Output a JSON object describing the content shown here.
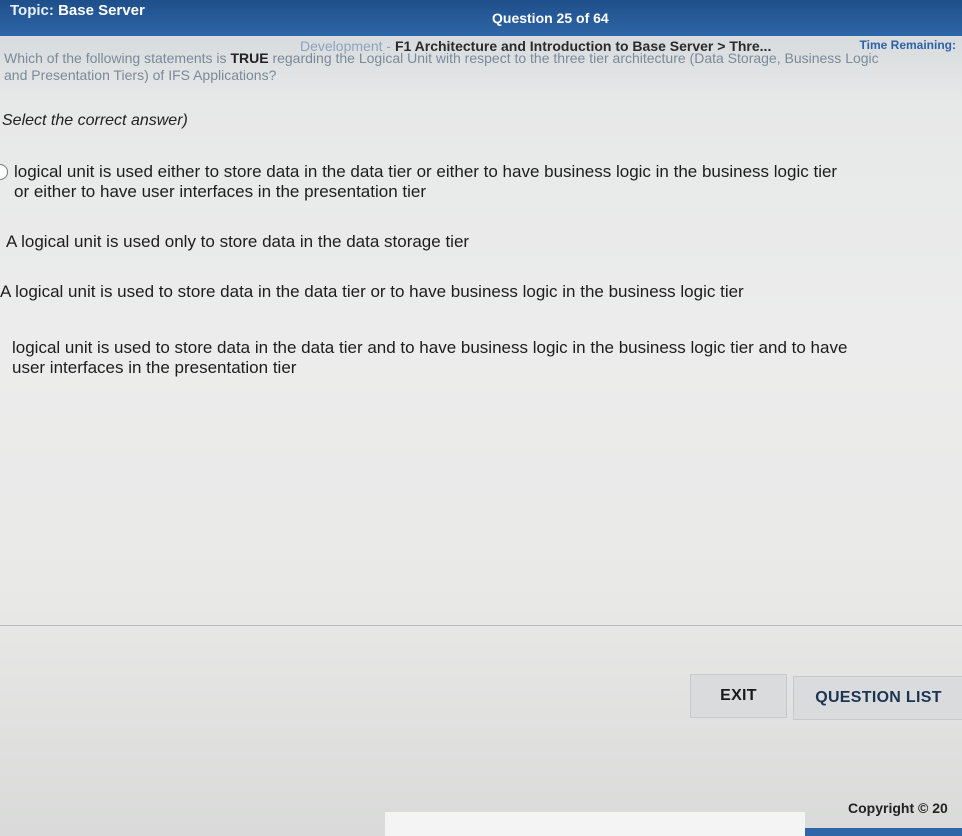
{
  "header": {
    "topic_label": "Topic:",
    "topic_name": "Base Server",
    "topic_faded": "Development - ",
    "topic_rest": "F1 Architecture and Introduction to Base Server > Thre...",
    "question_counter": "Question 25 of 64",
    "time_remaining": "Time Remaining:"
  },
  "question": {
    "text_part1": "Which of the following statements is ",
    "emphasis": "TRUE",
    "text_part2": " regarding the Logical Unit with respect to the three tier architecture (Data Storage, Business Logic and Presentation Tiers) of IFS Applications?",
    "instruction": "Select the correct answer)"
  },
  "options": [
    {
      "text": "logical unit is used either to store data in the data tier or either to have business logic in the business logic tier or either to have user interfaces in the presentation tier"
    },
    {
      "text": "A logical unit is used only to store data in the data storage tier"
    },
    {
      "text": "A logical unit is used to store data in the data tier or to have business logic in the business logic tier"
    },
    {
      "text": "logical unit is used to store data in the data tier and to have business logic in the business logic tier and to have user interfaces in the presentation tier"
    }
  ],
  "footer": {
    "exit_label": "EXIT",
    "question_list_label": "QUESTION LIST",
    "copyright": "Copyright © 20"
  },
  "colors": {
    "topbar": "#2f66a8",
    "accent": "#2d63a6"
  }
}
